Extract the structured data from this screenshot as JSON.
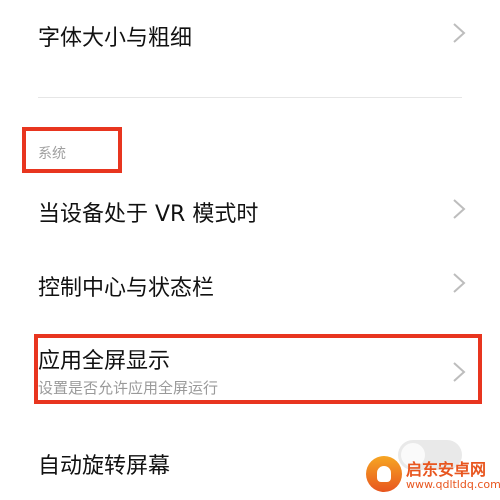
{
  "items": [
    {
      "label": "字体大小与粗细"
    },
    {
      "label": "当设备处于 VR 模式时"
    },
    {
      "label": "控制中心与状态栏"
    },
    {
      "label": "应用全屏显示",
      "subtitle": "设置是否允许应用全屏运行"
    },
    {
      "label": "自动旋转屏幕",
      "toggle_state": "off"
    }
  ],
  "section": {
    "title": "系统"
  },
  "watermark": {
    "title": "启东安卓网",
    "url": "www.qdltldq.com"
  },
  "colors": {
    "highlight": "#e8351f",
    "accent": "#e8561f"
  }
}
